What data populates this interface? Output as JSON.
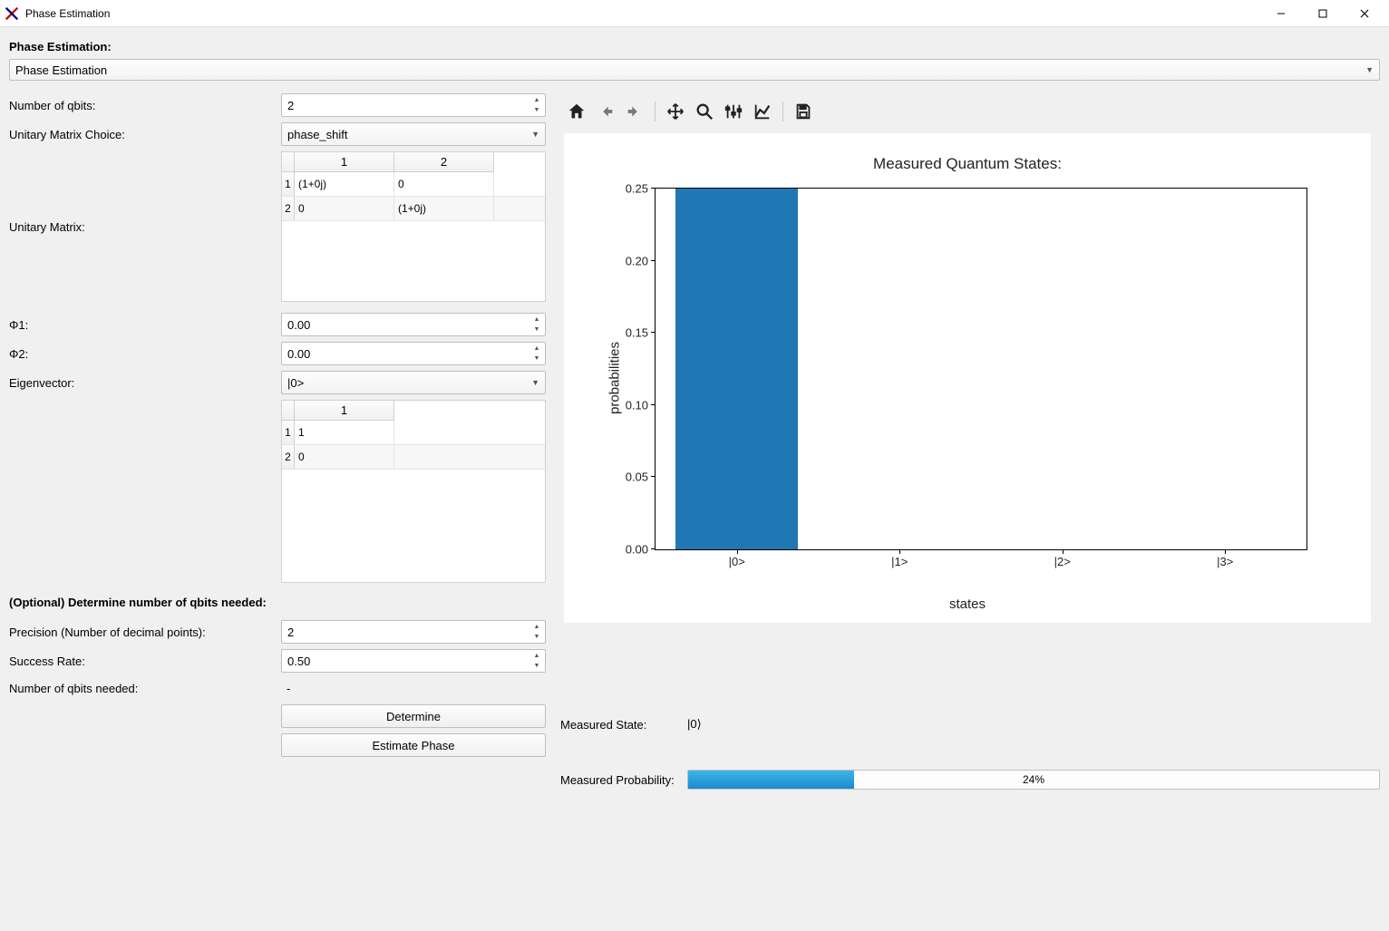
{
  "window_title": "Phase Estimation",
  "header": "Phase Estimation:",
  "top_combo_value": "Phase Estimation",
  "left": {
    "num_qbits_label": "Number of qbits:",
    "num_qbits_value": "2",
    "unitary_choice_label": "Unitary Matrix Choice:",
    "unitary_choice_value": "phase_shift",
    "unitary_matrix_label": "Unitary Matrix:",
    "unitary_matrix": {
      "col_headers": [
        "1",
        "2"
      ],
      "row_headers": [
        "1",
        "2"
      ],
      "cells": [
        [
          "(1+0j)",
          "0"
        ],
        [
          "0",
          "(1+0j)"
        ]
      ]
    },
    "phi1_label": "Φ1:",
    "phi1_value": "0.00",
    "phi2_label": "Φ2:",
    "phi2_value": "0.00",
    "eigenvector_label": "Eigenvector:",
    "eigenvector_value": "|0>",
    "eigenvector_matrix": {
      "col_headers": [
        "1"
      ],
      "row_headers": [
        "1",
        "2"
      ],
      "cells": [
        [
          "1"
        ],
        [
          "0"
        ]
      ]
    },
    "optional_header": "(Optional) Determine number of qbits needed:",
    "precision_label": "Precision (Number of decimal points):",
    "precision_value": "2",
    "success_label": "Success Rate:",
    "success_value": "0.50",
    "needed_label": "Number of qbits needed:",
    "needed_value": "-",
    "determine_btn": "Determine",
    "estimate_btn": "Estimate Phase"
  },
  "results": {
    "measured_state_label": "Measured State:",
    "measured_state_value": "|0⟩",
    "measured_prob_label": "Measured Probability:",
    "measured_prob_text": "24%",
    "measured_prob_pct": 24
  },
  "chart_data": {
    "type": "bar",
    "title": "Measured Quantum States:",
    "xlabel": "states",
    "ylabel": "probabilities",
    "categories": [
      "|0>",
      "|1>",
      "|2>",
      "|3>"
    ],
    "values": [
      0.25,
      0,
      0,
      0
    ],
    "ylim": [
      0,
      0.25
    ],
    "yticks": [
      0.0,
      0.05,
      0.1,
      0.15,
      0.2,
      0.25
    ]
  }
}
